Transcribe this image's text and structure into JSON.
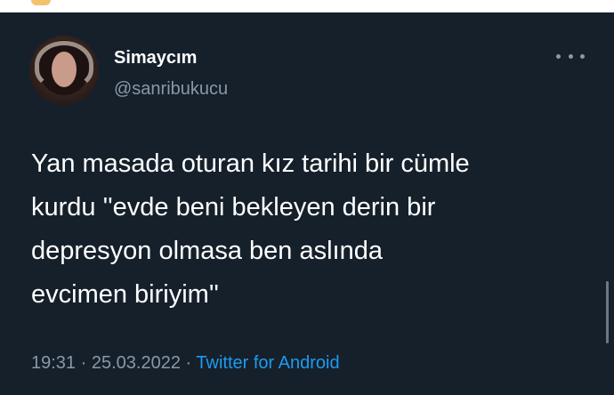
{
  "tweet": {
    "display_name": "Simaycım",
    "handle": "@sanribukucu",
    "text_lines": [
      "Yan masada oturan kız tarihi bir cümle",
      "kurdu ''evde beni bekleyen derin bir",
      "depresyon olmasa ben aslında",
      "evcimen biriyim''"
    ],
    "time": "19:31",
    "separator": "·",
    "date": "25.03.2022",
    "source": "Twitter for Android"
  },
  "icons": {
    "avatar": "avatar-photo",
    "more": "more-options-icon"
  },
  "colors": {
    "background": "#15202b",
    "text": "#ffffff",
    "muted": "#8b98a5",
    "link": "#1d9bf0"
  }
}
